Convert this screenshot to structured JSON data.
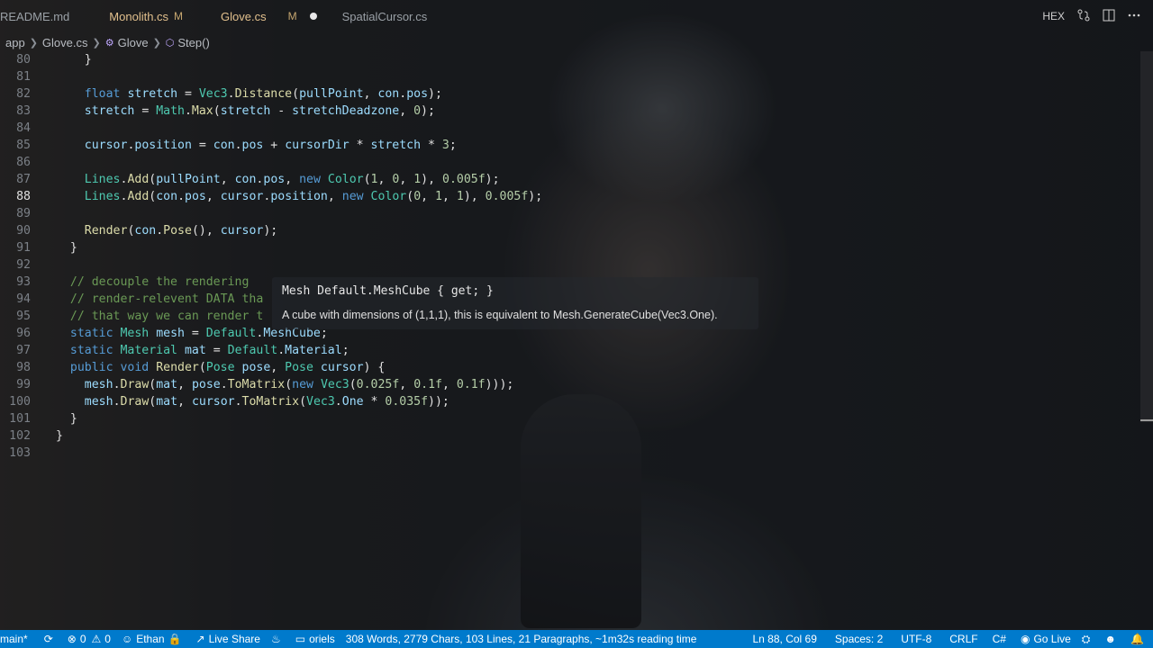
{
  "tabs": [
    {
      "label": "README.md",
      "mod": "",
      "dirty": false,
      "active": false
    },
    {
      "label": "Monolith.cs",
      "mod": "M",
      "dirty": false,
      "active": false
    },
    {
      "label": "Glove.cs",
      "mod": "M",
      "dirty": true,
      "active": true
    },
    {
      "label": "SpatialCursor.cs",
      "mod": "",
      "dirty": false,
      "active": false
    }
  ],
  "tab_actions": {
    "hex": "HEX"
  },
  "breadcrumb": {
    "folder": "app",
    "file": "Glove.cs",
    "class": "Glove",
    "method": "Step()"
  },
  "editor": {
    "current_line": 88,
    "lines": [
      {
        "n": 80,
        "indent": 4,
        "tokens": [
          [
            "}",
            "pl"
          ]
        ]
      },
      {
        "n": 81,
        "indent": 0,
        "tokens": []
      },
      {
        "n": 82,
        "indent": 4,
        "tokens": [
          [
            "float",
            "kw"
          ],
          [
            " ",
            "pl"
          ],
          [
            "stretch",
            "va"
          ],
          [
            " = ",
            "pl"
          ],
          [
            "Vec3",
            "ty"
          ],
          [
            ".",
            "pl"
          ],
          [
            "Distance",
            "fn"
          ],
          [
            "(",
            "pl"
          ],
          [
            "pullPoint",
            "va"
          ],
          [
            ", ",
            "pl"
          ],
          [
            "con",
            "va"
          ],
          [
            ".",
            "pl"
          ],
          [
            "pos",
            "va"
          ],
          [
            ");",
            "pl"
          ]
        ]
      },
      {
        "n": 83,
        "indent": 4,
        "tokens": [
          [
            "stretch",
            "va"
          ],
          [
            " = ",
            "pl"
          ],
          [
            "Math",
            "ty"
          ],
          [
            ".",
            "pl"
          ],
          [
            "Max",
            "fn"
          ],
          [
            "(",
            "pl"
          ],
          [
            "stretch",
            "va"
          ],
          [
            " - ",
            "pl"
          ],
          [
            "stretchDeadzone",
            "va"
          ],
          [
            ", ",
            "pl"
          ],
          [
            "0",
            "nu"
          ],
          [
            ");",
            "pl"
          ]
        ]
      },
      {
        "n": 84,
        "indent": 0,
        "tokens": []
      },
      {
        "n": 85,
        "indent": 4,
        "tokens": [
          [
            "cursor",
            "va"
          ],
          [
            ".",
            "pl"
          ],
          [
            "position",
            "va"
          ],
          [
            " = ",
            "pl"
          ],
          [
            "con",
            "va"
          ],
          [
            ".",
            "pl"
          ],
          [
            "pos",
            "va"
          ],
          [
            " + ",
            "pl"
          ],
          [
            "cursorDir",
            "va"
          ],
          [
            " * ",
            "pl"
          ],
          [
            "stretch",
            "va"
          ],
          [
            " * ",
            "pl"
          ],
          [
            "3",
            "nu"
          ],
          [
            ";",
            "pl"
          ]
        ]
      },
      {
        "n": 86,
        "indent": 0,
        "tokens": []
      },
      {
        "n": 87,
        "indent": 4,
        "tokens": [
          [
            "Lines",
            "ty"
          ],
          [
            ".",
            "pl"
          ],
          [
            "Add",
            "fn"
          ],
          [
            "(",
            "pl"
          ],
          [
            "pullPoint",
            "va"
          ],
          [
            ", ",
            "pl"
          ],
          [
            "con",
            "va"
          ],
          [
            ".",
            "pl"
          ],
          [
            "pos",
            "va"
          ],
          [
            ", ",
            "pl"
          ],
          [
            "new",
            "kw"
          ],
          [
            " ",
            "pl"
          ],
          [
            "Color",
            "ty"
          ],
          [
            "(",
            "pl"
          ],
          [
            "1",
            "nu"
          ],
          [
            ", ",
            "pl"
          ],
          [
            "0",
            "nu"
          ],
          [
            ", ",
            "pl"
          ],
          [
            "1",
            "nu"
          ],
          [
            "), ",
            "pl"
          ],
          [
            "0.005f",
            "nu"
          ],
          [
            ");",
            "pl"
          ]
        ]
      },
      {
        "n": 88,
        "indent": 4,
        "tokens": [
          [
            "Lines",
            "ty"
          ],
          [
            ".",
            "pl"
          ],
          [
            "Add",
            "fn"
          ],
          [
            "(",
            "pl"
          ],
          [
            "con",
            "va"
          ],
          [
            ".",
            "pl"
          ],
          [
            "pos",
            "va"
          ],
          [
            ", ",
            "pl"
          ],
          [
            "cursor",
            "va"
          ],
          [
            ".",
            "pl"
          ],
          [
            "position",
            "va"
          ],
          [
            ", ",
            "pl"
          ],
          [
            "new",
            "kw"
          ],
          [
            " ",
            "pl"
          ],
          [
            "Color",
            "ty"
          ],
          [
            "(",
            "pl"
          ],
          [
            "0",
            "nu"
          ],
          [
            ", ",
            "pl"
          ],
          [
            "1",
            "nu"
          ],
          [
            ", ",
            "pl"
          ],
          [
            "1",
            "nu"
          ],
          [
            "), ",
            "pl"
          ],
          [
            "0.005f",
            "nu"
          ],
          [
            ");",
            "pl"
          ]
        ]
      },
      {
        "n": 89,
        "indent": 0,
        "tokens": []
      },
      {
        "n": 90,
        "indent": 4,
        "tokens": [
          [
            "Render",
            "fn"
          ],
          [
            "(",
            "pl"
          ],
          [
            "con",
            "va"
          ],
          [
            ".",
            "pl"
          ],
          [
            "Pose",
            "fn"
          ],
          [
            "(), ",
            "pl"
          ],
          [
            "cursor",
            "va"
          ],
          [
            ");",
            "pl"
          ]
        ]
      },
      {
        "n": 91,
        "indent": 2,
        "tokens": [
          [
            "}",
            "pl"
          ]
        ]
      },
      {
        "n": 92,
        "indent": 0,
        "tokens": []
      },
      {
        "n": 93,
        "indent": 2,
        "tokens": [
          [
            "// decouple the rendering",
            "cm"
          ]
        ]
      },
      {
        "n": 94,
        "indent": 2,
        "tokens": [
          [
            "// render-relevent DATA tha",
            "cm"
          ]
        ]
      },
      {
        "n": 95,
        "indent": 2,
        "tokens": [
          [
            "// that way we can render t",
            "cm"
          ]
        ]
      },
      {
        "n": 96,
        "indent": 2,
        "tokens": [
          [
            "static",
            "kw"
          ],
          [
            " ",
            "pl"
          ],
          [
            "Mesh",
            "ty"
          ],
          [
            " ",
            "pl"
          ],
          [
            "mesh",
            "va"
          ],
          [
            " = ",
            "pl"
          ],
          [
            "Default",
            "ty"
          ],
          [
            ".",
            "pl"
          ],
          [
            "MeshCube",
            "va"
          ],
          [
            ";",
            "pl"
          ]
        ]
      },
      {
        "n": 97,
        "indent": 2,
        "tokens": [
          [
            "static",
            "kw"
          ],
          [
            " ",
            "pl"
          ],
          [
            "Material",
            "ty"
          ],
          [
            " ",
            "pl"
          ],
          [
            "mat",
            "va"
          ],
          [
            " = ",
            "pl"
          ],
          [
            "Default",
            "ty"
          ],
          [
            ".",
            "pl"
          ],
          [
            "Material",
            "va"
          ],
          [
            ";",
            "pl"
          ]
        ]
      },
      {
        "n": 98,
        "indent": 2,
        "tokens": [
          [
            "public",
            "kw"
          ],
          [
            " ",
            "pl"
          ],
          [
            "void",
            "kw"
          ],
          [
            " ",
            "pl"
          ],
          [
            "Render",
            "fn"
          ],
          [
            "(",
            "pl"
          ],
          [
            "Pose",
            "ty"
          ],
          [
            " ",
            "pl"
          ],
          [
            "pose",
            "va"
          ],
          [
            ", ",
            "pl"
          ],
          [
            "Pose",
            "ty"
          ],
          [
            " ",
            "pl"
          ],
          [
            "cursor",
            "va"
          ],
          [
            ") {",
            "pl"
          ]
        ]
      },
      {
        "n": 99,
        "indent": 4,
        "tokens": [
          [
            "mesh",
            "va"
          ],
          [
            ".",
            "pl"
          ],
          [
            "Draw",
            "fn"
          ],
          [
            "(",
            "pl"
          ],
          [
            "mat",
            "va"
          ],
          [
            ", ",
            "pl"
          ],
          [
            "pose",
            "va"
          ],
          [
            ".",
            "pl"
          ],
          [
            "ToMatrix",
            "fn"
          ],
          [
            "(",
            "pl"
          ],
          [
            "new",
            "kw"
          ],
          [
            " ",
            "pl"
          ],
          [
            "Vec3",
            "ty"
          ],
          [
            "(",
            "pl"
          ],
          [
            "0.025f",
            "nu"
          ],
          [
            ", ",
            "pl"
          ],
          [
            "0.1f",
            "nu"
          ],
          [
            ", ",
            "pl"
          ],
          [
            "0.1f",
            "nu"
          ],
          [
            ")));",
            "pl"
          ]
        ]
      },
      {
        "n": 100,
        "indent": 4,
        "tokens": [
          [
            "mesh",
            "va"
          ],
          [
            ".",
            "pl"
          ],
          [
            "Draw",
            "fn"
          ],
          [
            "(",
            "pl"
          ],
          [
            "mat",
            "va"
          ],
          [
            ", ",
            "pl"
          ],
          [
            "cursor",
            "va"
          ],
          [
            ".",
            "pl"
          ],
          [
            "ToMatrix",
            "fn"
          ],
          [
            "(",
            "pl"
          ],
          [
            "Vec3",
            "ty"
          ],
          [
            ".",
            "pl"
          ],
          [
            "One",
            "va"
          ],
          [
            " * ",
            "pl"
          ],
          [
            "0.035f",
            "nu"
          ],
          [
            "));",
            "pl"
          ]
        ]
      },
      {
        "n": 101,
        "indent": 2,
        "tokens": [
          [
            "}",
            "pl"
          ]
        ]
      },
      {
        "n": 102,
        "indent": 0,
        "tokens": [
          [
            "}",
            "pl"
          ]
        ]
      },
      {
        "n": 103,
        "indent": 0,
        "tokens": []
      }
    ]
  },
  "hover": {
    "signature": "Mesh Default.MeshCube { get; }",
    "doc": "A cube with dimensions of (1,1,1), this is equivalent to Mesh.GenerateCube(Vec3.One)."
  },
  "status": {
    "branch": "main*",
    "errors": "0",
    "warnings": "0",
    "user": "Ethan",
    "live_share": "Live Share",
    "project": "oriels",
    "word_count": "308 Words, 2779 Chars, 103 Lines, 21 Paragraphs, ~1m32s reading time",
    "cursor_pos": "Ln 88, Col 69",
    "spaces": "Spaces: 2",
    "encoding": "UTF-8",
    "eol": "CRLF",
    "language": "C#",
    "go_live": "Go Live"
  },
  "colors": {
    "statusbar": "#007acc",
    "keyword": "#569cd6",
    "type": "#4ec9b0",
    "function": "#dcdcaa",
    "variable": "#9cdcfe",
    "number": "#b5cea8",
    "comment": "#6a9955"
  }
}
